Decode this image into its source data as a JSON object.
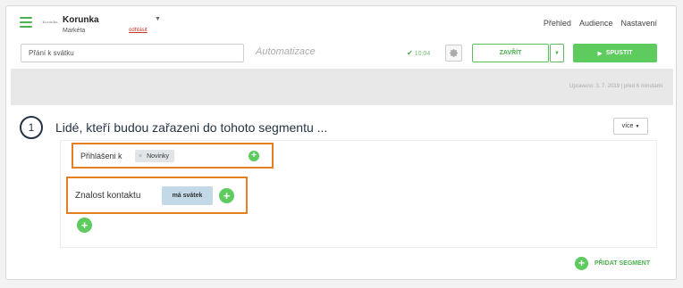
{
  "header": {
    "org_name": "Korunka",
    "logo_text": "Korunka",
    "user_name": "Markéta",
    "logout_label": "odhlásit",
    "nav": [
      "Přehled",
      "Audience",
      "Nastavení"
    ]
  },
  "toolbar": {
    "name_value": "Přání k svátku",
    "automation_label": "Automatizace",
    "saved_time": "10:04",
    "close_label": "ZAVŘÍT",
    "run_label": "SPUSTIT"
  },
  "updated_text": "Upraveno: 3. 7. 2019 | před 6 minutami",
  "segment": {
    "number": "1",
    "title": "Lidé, kteří budou zařazeni do tohoto segmentu ...",
    "more_label": "více",
    "condition1": {
      "label": "Přihlášeni k",
      "tag": "Novinky"
    },
    "condition2": {
      "label": "Znalost kontaktu",
      "badge": "má svátek"
    },
    "add_segment_label": "PŘIDAT SEGMENT"
  },
  "colors": {
    "accent_green": "#5ecb5f",
    "highlight_orange": "#e67e22",
    "title_navy": "#263445"
  }
}
